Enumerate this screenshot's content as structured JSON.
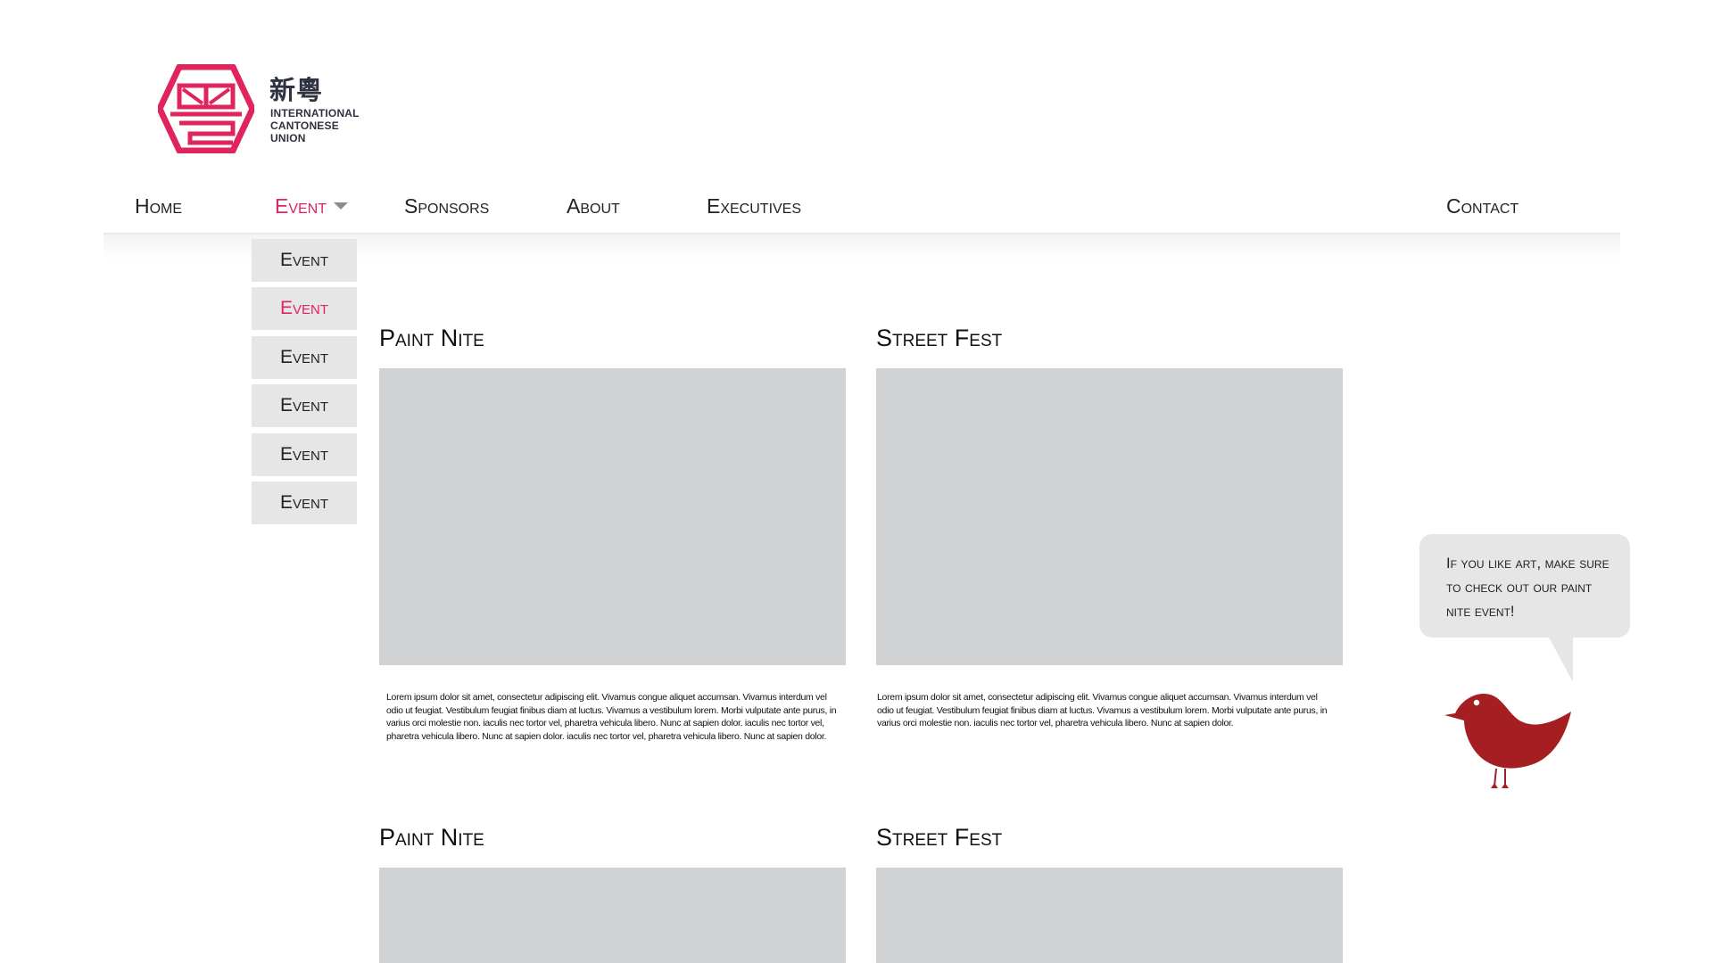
{
  "logo": {
    "cjk": "新粵",
    "lines": [
      "INTERNATIONAL",
      "CANTONESE",
      "UNION"
    ],
    "brand_color": "#e0245e"
  },
  "nav": {
    "items": [
      {
        "label": "Home"
      },
      {
        "label": "Event",
        "active": true,
        "has_dropdown": true
      },
      {
        "label": "Sponsors"
      },
      {
        "label": "About"
      },
      {
        "label": "Executives"
      },
      {
        "label": "Contact"
      }
    ]
  },
  "dropdown": {
    "items": [
      {
        "label": "Event"
      },
      {
        "label": "Event",
        "active": true
      },
      {
        "label": "Event"
      },
      {
        "label": "Event"
      },
      {
        "label": "Event"
      },
      {
        "label": "Event"
      }
    ]
  },
  "cards": [
    {
      "title": "Paint Nite",
      "text": "Lorem ipsum dolor sit amet, consectetur adipiscing elit. Vivamus congue aliquet accumsan. Vivamus interdum vel odio ut feugiat. Vestibulum feugiat finibus diam at luctus. Vivamus a vestibulum lorem. Morbi vulputate ante purus, in varius orci molestie non. iaculis nec tortor vel, pharetra vehicula libero. Nunc at sapien dolor.  iaculis nec tortor vel, pharetra vehicula libero. Nunc at sapien dolor.  iaculis nec tortor vel, pharetra vehicula libero. Nunc at sapien dolor."
    },
    {
      "title": "Street Fest",
      "text": "Lorem ipsum dolor sit amet, consectetur adipiscing elit. Vivamus congue aliquet accumsan. Vivamus interdum vel odio ut feugiat. Vestibulum feugiat finibus diam at luctus. Vivamus a vestibulum lorem. Morbi vulputate ante purus, in varius orci molestie non. iaculis nec tortor vel, pharetra vehicula libero. Nunc at sapien dolor."
    },
    {
      "title": "Paint Nite"
    },
    {
      "title": "Street Fest"
    }
  ],
  "bubble": {
    "text": "If you like art, make sure to check out our paint nite event!"
  },
  "colors": {
    "accent": "#e0245e",
    "bird": "#a51e22",
    "placeholder": "#d1d2d4",
    "menu_bg": "#e6e6e6"
  }
}
